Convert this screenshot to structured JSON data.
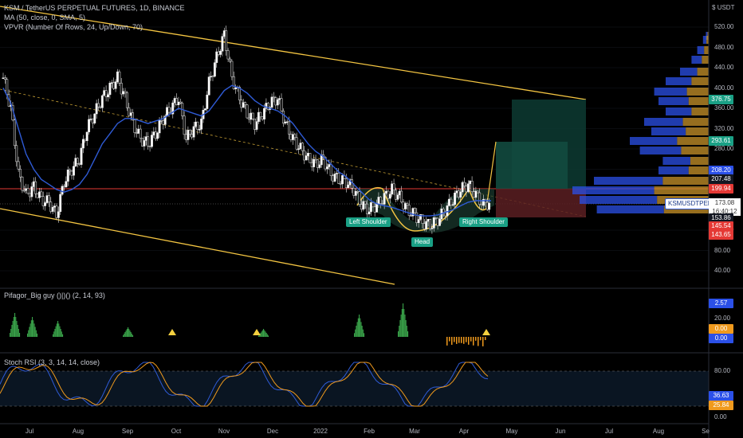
{
  "header": {
    "symbol_line": "KSM / TetherUS PERPETUAL FUTURES, 1D, BINANCE",
    "ma_line": "MA (50, close, 0, SMA, 5)",
    "vpvr_line": "VPVR (Number Of Rows, 24, Up/Down, 70)"
  },
  "currency": "USDT",
  "currency_glyph": "$",
  "price_axis": {
    "labels": [
      "520.00",
      "480.00",
      "440.00",
      "400.00",
      "360.00",
      "320.00",
      "280.00",
      "240.00",
      "120.00",
      "80.00",
      "40.00"
    ]
  },
  "price_tags": [
    {
      "value": "376.75",
      "color": "#1aa085"
    },
    {
      "value": "293.61",
      "color": "#1aa085"
    },
    {
      "value": "208.20",
      "color": "#2b50e8"
    },
    {
      "value": "207.48",
      "color": "#131722"
    },
    {
      "value": "199.94",
      "color": "#e53935"
    },
    {
      "value": "153.86",
      "color": "#131722"
    },
    {
      "value": "145.54",
      "color": "#e53935"
    },
    {
      "value": "143.65",
      "color": "#e53935"
    }
  ],
  "last_price": {
    "symbol": "KSMUSDTPERP",
    "price": "173.08",
    "countdown": "16:40:12"
  },
  "pattern_labels": {
    "left": "Left Shoulder",
    "head": "Head",
    "right": "Right Shoulder"
  },
  "indicator1": {
    "legend": "Pifagor_Big guy ()|)() (2, 14, 93)",
    "axis": [
      "20.00",
      "0.00"
    ],
    "tags": [
      {
        "value": "2.57",
        "color": "#2b50e8"
      },
      {
        "value": "0.00",
        "color": "#f09a1d"
      },
      {
        "value": "0.00",
        "color": "#2b50e8"
      }
    ]
  },
  "indicator2": {
    "legend": "Stoch RSI (3, 3, 14, 14, close)",
    "axis": [
      "80.00",
      "0.00"
    ],
    "tags": [
      {
        "value": "36.63",
        "color": "#2b50e8"
      },
      {
        "value": "25.84",
        "color": "#f09a1d"
      }
    ]
  },
  "time_axis": [
    "Jul",
    "Aug",
    "Sep",
    "Oct",
    "Nov",
    "Dec",
    "2022",
    "Feb",
    "Mar",
    "Apr",
    "May",
    "Jun",
    "Jul",
    "Aug",
    "Se"
  ],
  "colors": {
    "up": "#ffffff",
    "down": "#ffffff",
    "ma": "#2f5bd6",
    "channel": "#f4c542",
    "support": "#e53935",
    "profit": "#1aa085",
    "loss": "#8b2a2a"
  },
  "chart_data": {
    "type": "candlestick",
    "series": [
      {
        "name": "close",
        "values": [
          420,
          360,
          230,
          190,
          205,
          180,
          175,
          150,
          215,
          240,
          260,
          320,
          350,
          380,
          400,
          420,
          380,
          330,
          300,
          290,
          310,
          340,
          360,
          380,
          300,
          320,
          330,
          410,
          460,
          505,
          420,
          380,
          350,
          330,
          350,
          370,
          380,
          330,
          300,
          280,
          260,
          250,
          260,
          230,
          220,
          215,
          200,
          170,
          160,
          170,
          185,
          200,
          185,
          160,
          150,
          135,
          130,
          140,
          160,
          180,
          200,
          210,
          190,
          170,
          175
        ]
      },
      {
        "name": "MA (50, close, 0, SMA, 5)",
        "values": [
          400,
          370,
          320,
          270,
          240,
          220,
          210,
          200,
          195,
          200,
          210,
          230,
          260,
          290,
          310,
          330,
          340,
          340,
          335,
          330,
          335,
          340,
          350,
          360,
          355,
          350,
          345,
          355,
          375,
          395,
          405,
          400,
          390,
          375,
          365,
          360,
          355,
          345,
          330,
          310,
          290,
          275,
          265,
          250,
          235,
          225,
          210,
          195,
          180,
          172,
          168,
          165,
          160,
          155,
          150,
          148,
          148,
          150,
          155,
          160,
          168,
          175,
          178,
          178,
          178
        ]
      }
    ]
  }
}
